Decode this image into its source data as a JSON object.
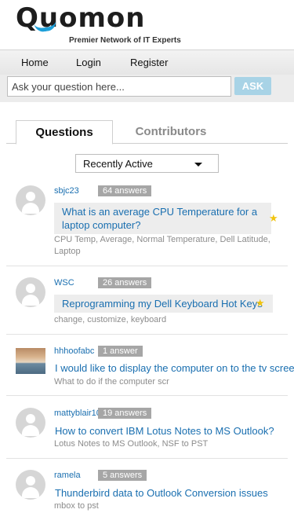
{
  "logo": {
    "wordmark": "Quomon",
    "tagline": "Premier Network of IT Experts"
  },
  "nav": {
    "home": "Home",
    "login": "Login",
    "register": "Register"
  },
  "search": {
    "placeholder": "Ask your question here...",
    "button": "ASK"
  },
  "tabs": {
    "questions": "Questions",
    "contributors": "Contributors"
  },
  "sort": {
    "selected": "Recently Active"
  },
  "questions": [
    {
      "user": "sbjc23",
      "answers": "64 answers",
      "title_line1": "What is an average CPU Temperature for a",
      "title_line2": "laptop computer?",
      "starred": true,
      "tags_line1": "CPU Temp, Average, Normal Temperature, Dell Latitude,",
      "tags_line2": "Laptop",
      "avatar": "avatar-placeholder-icon"
    },
    {
      "user": "WSC",
      "answers": "26 answers",
      "title": "Reprogramming my Dell Keyboard Hot Keys",
      "starred": true,
      "tags": "change, customize, keyboard",
      "avatar": "avatar-placeholder-icon"
    },
    {
      "user": "hhhoofabc",
      "answers": "1 answer",
      "title": "I would like to display the computer on to the tv screen.",
      "starred": false,
      "tags": "What to do if the computer scr",
      "avatar": "beach-photo"
    },
    {
      "user": "mattyblair10",
      "answers": "19 answers",
      "title": "How to convert IBM Lotus Notes to MS Outlook?",
      "starred": false,
      "tags": "Lotus Notes to MS Outlook, NSF to PST",
      "avatar": "avatar-placeholder-icon"
    },
    {
      "user": "ramela",
      "answers": "5 answers",
      "title": "Thunderbird data to Outlook Conversion issues",
      "starred": false,
      "tags": "mbox to pst",
      "avatar": "avatar-placeholder-icon"
    }
  ],
  "colors": {
    "accent": "#1ea0d9",
    "link": "#1a6fb0",
    "ask_button": "#a8d3e6",
    "badge": "#a6a6a6",
    "star": "#f1c40f"
  }
}
